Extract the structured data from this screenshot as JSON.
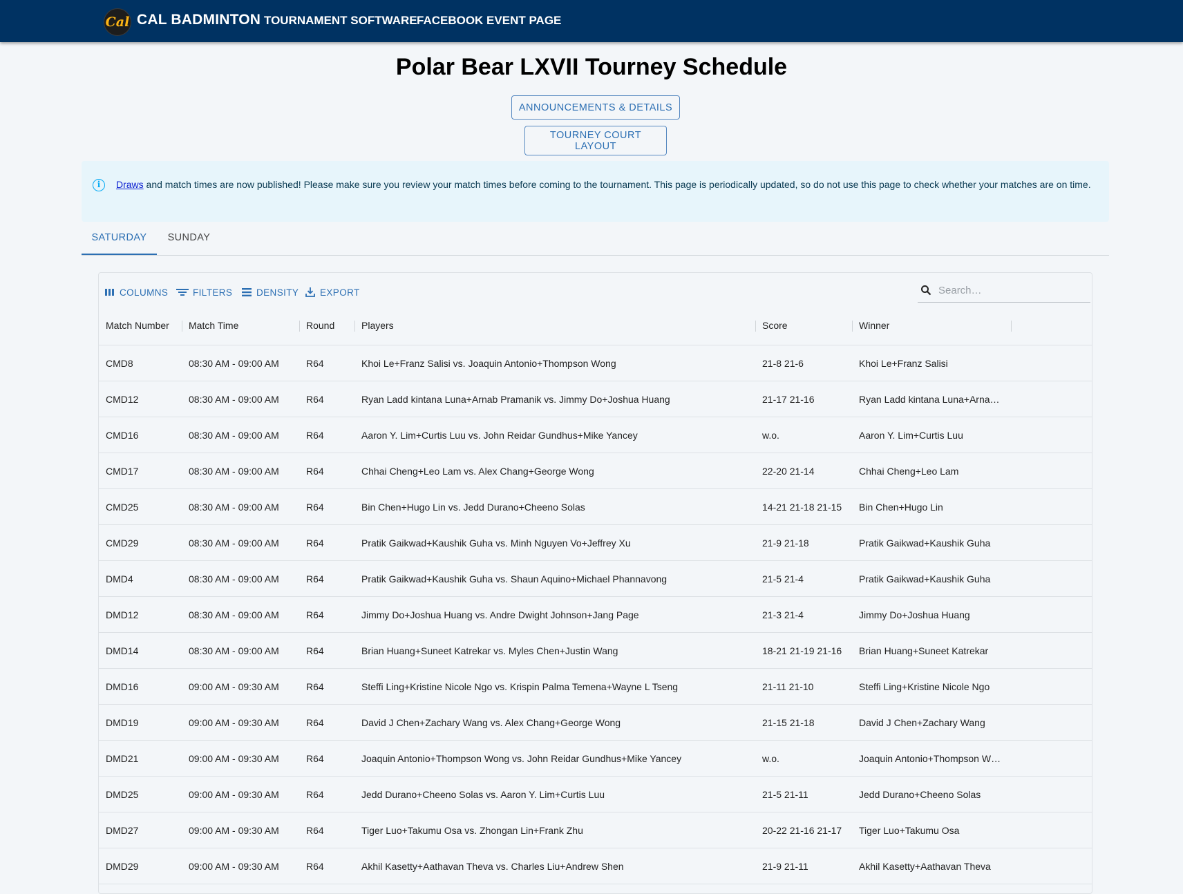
{
  "nav": {
    "logo_text": "Cal",
    "brand": "CAL BADMINTON",
    "links": [
      "TOURNAMENT SOFTWARE",
      "FACEBOOK EVENT PAGE"
    ]
  },
  "page": {
    "title": "Polar Bear LXVII Tourney Schedule",
    "buttons": [
      "ANNOUNCEMENTS & DETAILS",
      "TOURNEY COURT LAYOUT"
    ]
  },
  "alert": {
    "link_text": "Draws",
    "text": " and match times are now published! Please make sure you review your match times before coming to the tournament. This page is periodically updated, so do not use this page to check whether your matches are on time."
  },
  "tabs": [
    "SATURDAY",
    "SUNDAY"
  ],
  "toolbar": {
    "columns": "COLUMNS",
    "filters": "FILTERS",
    "density": "DENSITY",
    "export": "EXPORT",
    "search_placeholder": "Search…"
  },
  "columns": [
    "Match Number",
    "Match Time",
    "Round",
    "Players",
    "Score",
    "Winner"
  ],
  "rows": [
    [
      "CMD8",
      "08:30 AM - 09:00 AM",
      "R64",
      "Khoi Le+Franz Salisi vs. Joaquin Antonio+Thompson Wong",
      "21-8 21-6",
      "Khoi Le+Franz Salisi"
    ],
    [
      "CMD12",
      "08:30 AM - 09:00 AM",
      "R64",
      "Ryan Ladd kintana Luna+Arnab Pramanik vs. Jimmy Do+Joshua Huang",
      "21-17 21-16",
      "Ryan Ladd kintana Luna+Arna…"
    ],
    [
      "CMD16",
      "08:30 AM - 09:00 AM",
      "R64",
      "Aaron Y. Lim+Curtis Luu vs. John Reidar Gundhus+Mike Yancey",
      "w.o.",
      "Aaron Y. Lim+Curtis Luu"
    ],
    [
      "CMD17",
      "08:30 AM - 09:00 AM",
      "R64",
      "Chhai Cheng+Leo Lam vs. Alex Chang+George Wong",
      "22-20 21-14",
      "Chhai Cheng+Leo Lam"
    ],
    [
      "CMD25",
      "08:30 AM - 09:00 AM",
      "R64",
      "Bin Chen+Hugo Lin vs. Jedd Durano+Cheeno Solas",
      "14-21 21-18 21-15",
      "Bin Chen+Hugo Lin"
    ],
    [
      "CMD29",
      "08:30 AM - 09:00 AM",
      "R64",
      "Pratik Gaikwad+Kaushik Guha vs. Minh Nguyen Vo+Jeffrey Xu",
      "21-9 21-18",
      "Pratik Gaikwad+Kaushik Guha"
    ],
    [
      "DMD4",
      "08:30 AM - 09:00 AM",
      "R64",
      "Pratik Gaikwad+Kaushik Guha vs. Shaun Aquino+Michael Phannavong",
      "21-5 21-4",
      "Pratik Gaikwad+Kaushik Guha"
    ],
    [
      "DMD12",
      "08:30 AM - 09:00 AM",
      "R64",
      "Jimmy Do+Joshua Huang vs. Andre Dwight Johnson+Jang Page",
      "21-3 21-4",
      "Jimmy Do+Joshua Huang"
    ],
    [
      "DMD14",
      "08:30 AM - 09:00 AM",
      "R64",
      "Brian Huang+Suneet Katrekar vs. Myles Chen+Justin Wang",
      "18-21 21-19 21-16",
      "Brian Huang+Suneet Katrekar"
    ],
    [
      "DMD16",
      "09:00 AM - 09:30 AM",
      "R64",
      "Steffi Ling+Kristine Nicole Ngo vs. Krispin Palma Temena+Wayne L Tseng",
      "21-11 21-10",
      "Steffi Ling+Kristine Nicole Ngo"
    ],
    [
      "DMD19",
      "09:00 AM - 09:30 AM",
      "R64",
      "David J Chen+Zachary Wang vs. Alex Chang+George Wong",
      "21-15 21-18",
      "David J Chen+Zachary Wang"
    ],
    [
      "DMD21",
      "09:00 AM - 09:30 AM",
      "R64",
      "Joaquin Antonio+Thompson Wong vs. John Reidar Gundhus+Mike Yancey",
      "w.o.",
      "Joaquin Antonio+Thompson W…"
    ],
    [
      "DMD25",
      "09:00 AM - 09:30 AM",
      "R64",
      "Jedd Durano+Cheeno Solas vs. Aaron Y. Lim+Curtis Luu",
      "21-5 21-11",
      "Jedd Durano+Cheeno Solas"
    ],
    [
      "DMD27",
      "09:00 AM - 09:30 AM",
      "R64",
      "Tiger Luo+Takumu Osa vs. Zhongan Lin+Frank Zhu",
      "20-22 21-16 21-17",
      "Tiger Luo+Takumu Osa"
    ],
    [
      "DMD29",
      "09:00 AM - 09:30 AM",
      "R64",
      "Akhil Kasetty+Aathavan Theva vs. Charles Liu+Andrew Shen",
      "21-9 21-11",
      "Akhil Kasetty+Aathavan Theva"
    ]
  ],
  "colors": {
    "nav_bg": "#003262",
    "accent": "#2c6fb3",
    "alert_bg": "#e7f5fb",
    "logo_gold": "#fdb515"
  },
  "icons": [
    "info-icon",
    "columns-icon",
    "filter-icon",
    "density-icon",
    "export-icon",
    "search-icon"
  ]
}
